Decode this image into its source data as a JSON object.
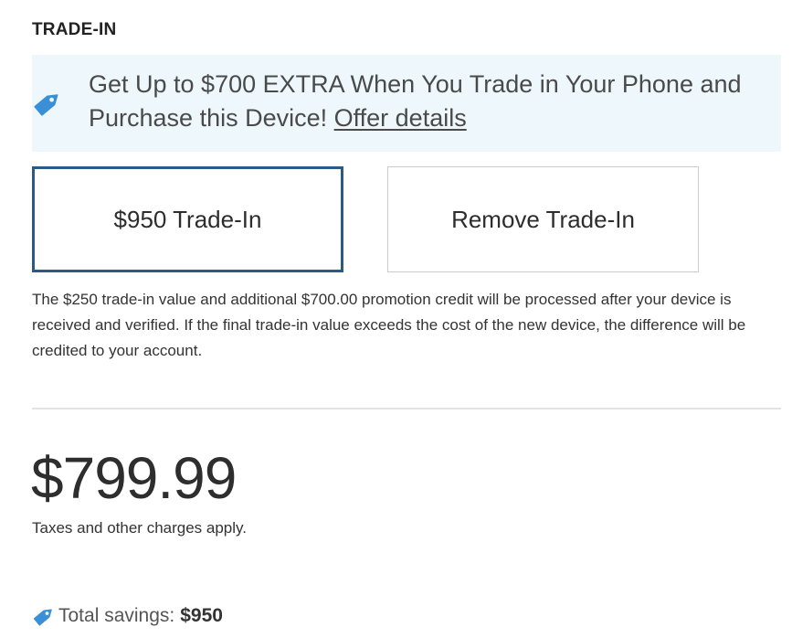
{
  "section": {
    "title": "TRADE-IN"
  },
  "promo": {
    "icon": "price-tag-icon",
    "text": "Get Up to $700 EXTRA When You Trade in Your Phone and Purchase this Device!",
    "link_label": "Offer details"
  },
  "options": {
    "selected_label": "$950 Trade-In",
    "remove_label": "Remove Trade-In"
  },
  "disclaimer": {
    "text": "The $250 trade-in value and additional $700.00 promotion credit will be processed after your device is received and verified. If the final trade-in value exceeds the cost of the new device, the difference will be credited to your account."
  },
  "pricing": {
    "price": "$799.99",
    "note": "Taxes and other charges apply."
  },
  "savings": {
    "icon": "price-tag-icon",
    "label": "Total savings:",
    "value": "$950"
  },
  "colors": {
    "banner_background": "#eef7fb",
    "selected_border": "#2b5a86",
    "tag_icon": "#3a8fd6"
  }
}
